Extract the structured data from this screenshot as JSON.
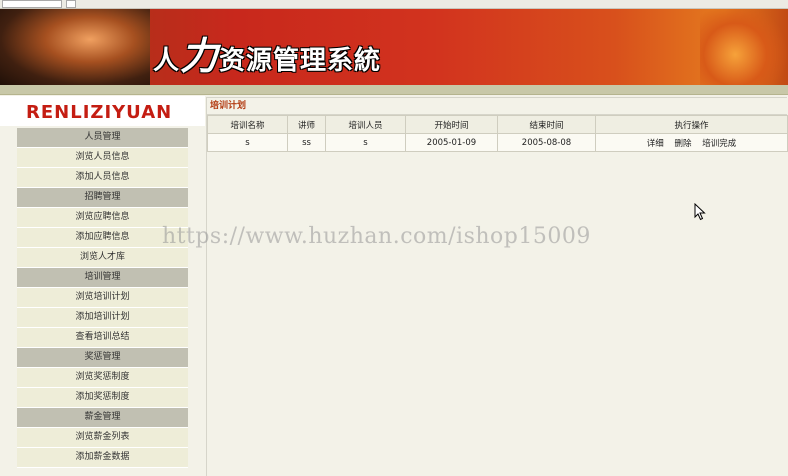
{
  "banner": {
    "title_prefix": "人",
    "title_big": "力",
    "title_rest": "资源管理系統"
  },
  "logo": {
    "text": "RENLIZIYUAN"
  },
  "sidebar": {
    "groups": [
      {
        "header": "人员管理",
        "items": [
          "浏览人员信息",
          "添加人员信息"
        ]
      },
      {
        "header": "招聘管理",
        "items": [
          "浏览应聘信息",
          "添加应聘信息",
          "浏览人才库"
        ]
      },
      {
        "header": "培训管理",
        "items": [
          "浏览培训计划",
          "添加培训计划",
          "查看培训总结"
        ]
      },
      {
        "header": "奖惩管理",
        "items": [
          "浏览奖惩制度",
          "添加奖惩制度"
        ]
      },
      {
        "header": "薪金管理",
        "items": [
          "浏览薪金列表",
          "添加薪金数据"
        ]
      }
    ]
  },
  "main": {
    "title": "培训计划",
    "columns": [
      "培训名称",
      "讲师",
      "培训人员",
      "开始时间",
      "结束时间",
      "执行操作"
    ],
    "rows": [
      {
        "name": "s",
        "teacher": "ss",
        "trainee": "s",
        "start": "2005-01-09",
        "end": "2005-08-08",
        "actions": [
          "详细",
          "删除",
          "培训完成"
        ]
      }
    ]
  },
  "watermark": "https://www.huzhan.com/ishop15009"
}
